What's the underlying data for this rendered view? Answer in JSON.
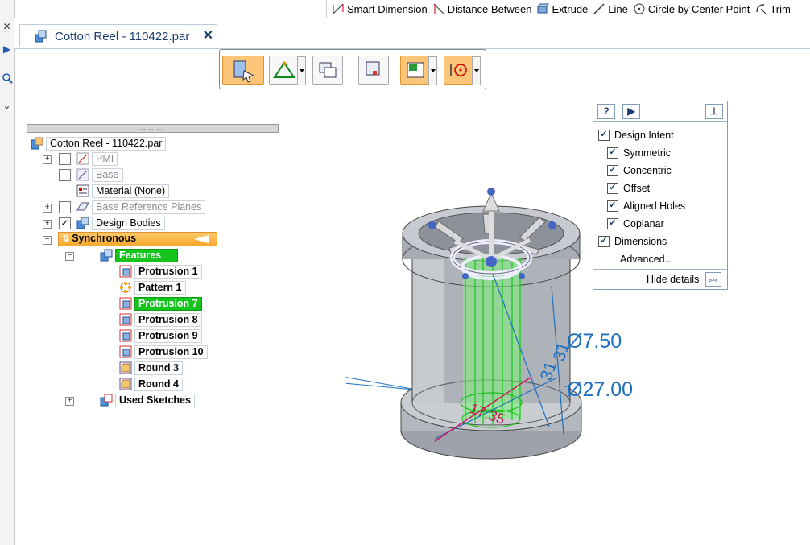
{
  "ribbon": {
    "items": [
      {
        "label": "Smart Dimension",
        "icon": "smart-dimension-icon"
      },
      {
        "label": "Distance Between",
        "icon": "distance-between-icon"
      },
      {
        "label": "Extrude",
        "icon": "extrude-icon"
      },
      {
        "label": "Line",
        "icon": "line-icon"
      },
      {
        "label": "Circle by Center Point",
        "icon": "circle-center-icon"
      },
      {
        "label": "Trim",
        "icon": "trim-icon"
      }
    ]
  },
  "document": {
    "tab_title": "Cotton Reel - 110422.par",
    "close": "✕"
  },
  "pathfinder": {
    "root": "Cotton Reel - 110422.par",
    "nodes": {
      "pmi": "PMI",
      "base": "Base",
      "material": "Material (None)",
      "base_ref_planes": "Base Reference Planes",
      "design_bodies": "Design Bodies",
      "synchronous": "Synchronous",
      "features": "Features",
      "protrusion1": "Protrusion 1",
      "pattern1": "Pattern 1",
      "protrusion7": "Protrusion 7",
      "protrusion8": "Protrusion 8",
      "protrusion9": "Protrusion 9",
      "protrusion10": "Protrusion 10",
      "round3": "Round 3",
      "round4": "Round 4",
      "used_sketches": "Used Sketches"
    }
  },
  "design_intent": {
    "help": "?",
    "play": "▶",
    "title": "Design Intent",
    "options": [
      "Symmetric",
      "Concentric",
      "Offset",
      "Aligned Holes",
      "Coplanar"
    ],
    "dimensions": "Dimensions",
    "advanced": "Advanced...",
    "hide_details": "Hide details"
  },
  "viewport": {
    "dims": {
      "d1": "Ø7.50",
      "d2": "Ø27.00",
      "v1": "31",
      "v2": "31",
      "diag": "17.35"
    }
  },
  "colors": {
    "accent_orange": "#fbc67a",
    "selection_green": "#15c41d",
    "dimension_blue": "#1f6fbf"
  }
}
